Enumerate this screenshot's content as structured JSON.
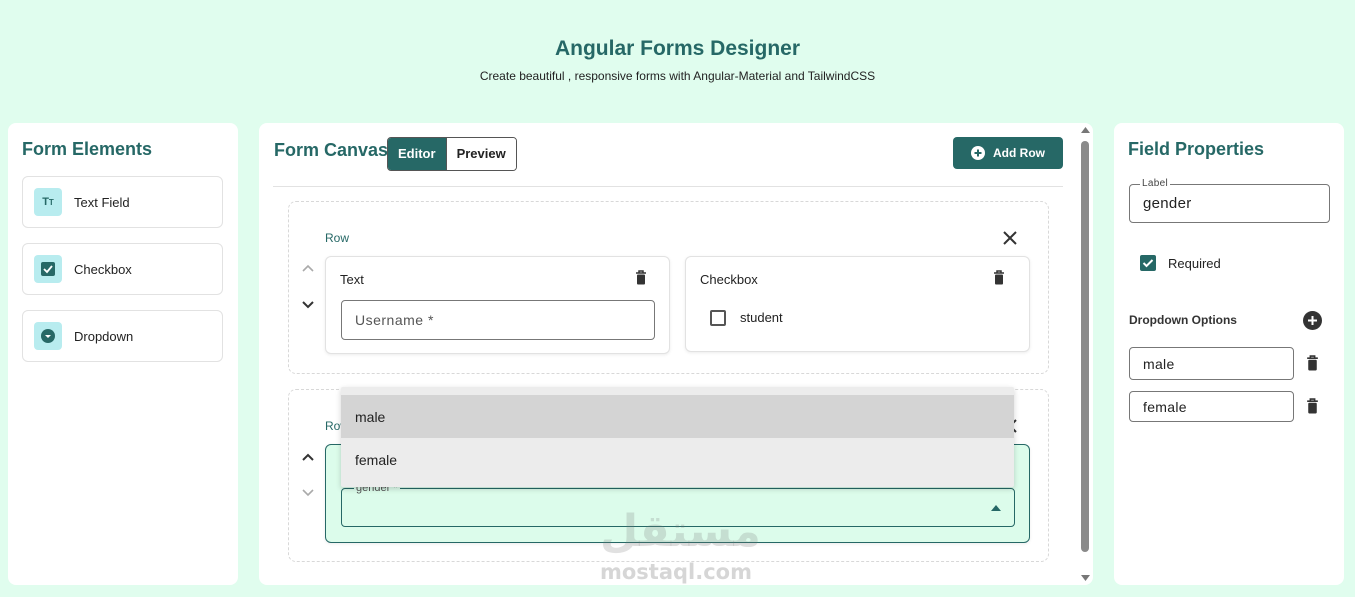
{
  "header": {
    "title": "Angular Forms Designer",
    "subtitle": "Create beautiful , responsive forms with Angular-Material and TailwindCSS"
  },
  "left_panel": {
    "title": "Form Elements",
    "elements": [
      {
        "label": "Text Field",
        "icon": "text-field-icon"
      },
      {
        "label": "Checkbox",
        "icon": "checkbox-icon"
      },
      {
        "label": "Dropdown",
        "icon": "dropdown-icon"
      }
    ]
  },
  "canvas": {
    "title": "Form Canvas",
    "toggle": {
      "editor": "Editor",
      "preview": "Preview",
      "active": "editor"
    },
    "add_row_label": "Add Row",
    "rows": [
      {
        "label": "Row",
        "fields": [
          {
            "type": "Text",
            "title": "Text",
            "placeholder": "Username *"
          },
          {
            "type": "Checkbox",
            "title": "Checkbox",
            "option": "student",
            "checked": false
          }
        ]
      },
      {
        "label": "Row",
        "fields": [
          {
            "type": "Dropdown",
            "label": "gender *",
            "value": ""
          }
        ]
      }
    ],
    "open_dropdown_options": [
      "male",
      "female"
    ],
    "highlighted_option": "male"
  },
  "right_panel": {
    "title": "Field Properties",
    "label_field": {
      "label": "Label",
      "value": "gender"
    },
    "required": {
      "label": "Required",
      "checked": true
    },
    "dropdown_options_title": "Dropdown Options",
    "options": [
      "male",
      "female"
    ]
  },
  "watermark": {
    "arabic": "مستقل",
    "latin": "mostaql.com"
  },
  "colors": {
    "background": "#e0fdee",
    "accent": "#266866",
    "selected_row_bg": "#dcfceb"
  }
}
